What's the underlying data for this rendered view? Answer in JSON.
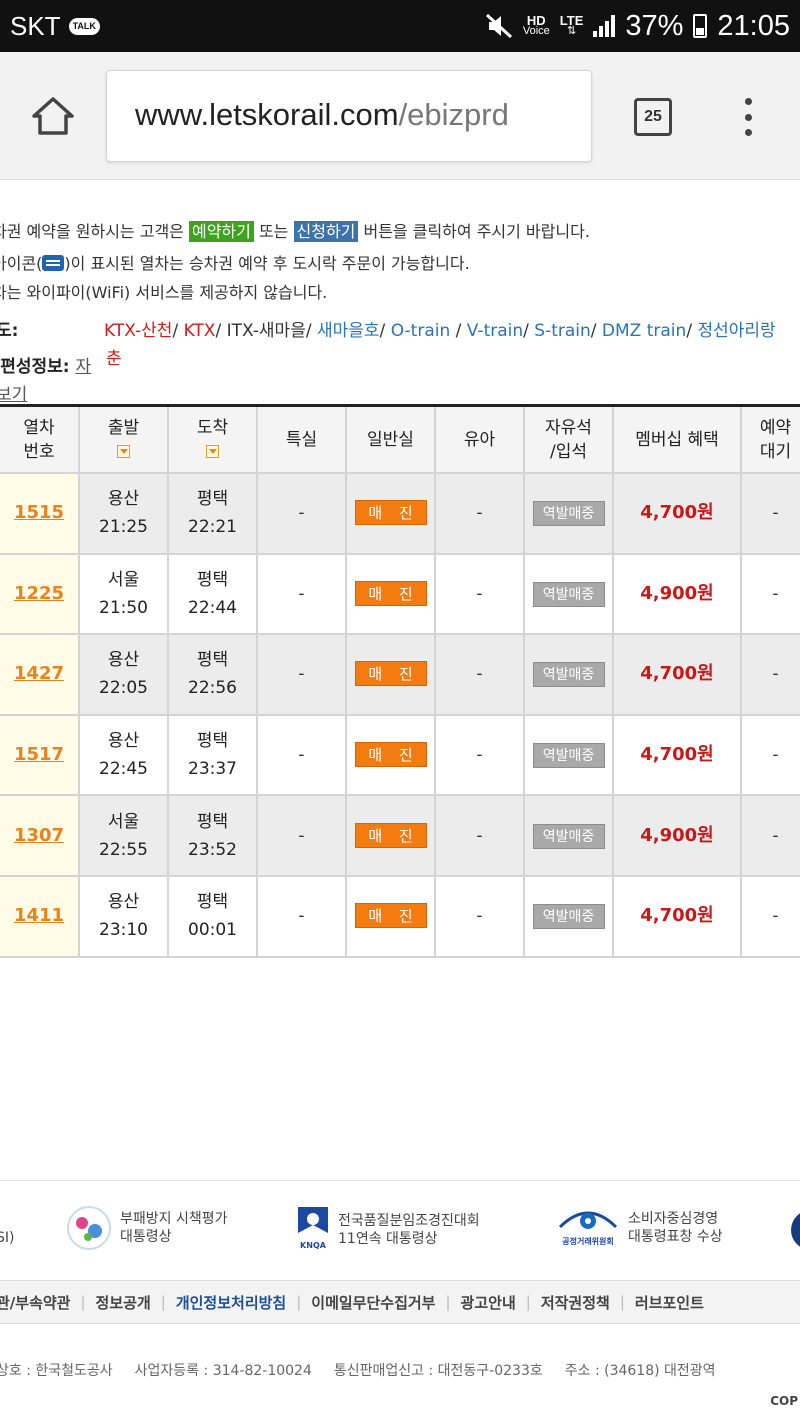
{
  "status": {
    "carrier": "SKT",
    "talk_badge": "TALK",
    "hd_label": "HD",
    "voice_label": "Voice",
    "lte_label": "LTE",
    "battery": "37%",
    "time": "21:05"
  },
  "browser": {
    "url_host": "www.letskorail.com",
    "url_path": "/ebizprd",
    "tab_count": "25"
  },
  "notices": {
    "line1_a": "차권 예약을 원하시는 고객은 ",
    "line1_reserve": "예약하기",
    "line1_b": " 또는 ",
    "line1_apply": "신청하기",
    "line1_c": " 버튼을 클릭하여 주시기 바랍니다.",
    "line2_a": "아이콘(",
    "line2_b": ")이 표시된 열차는 승차권 예약 후 도시락 주문이 가능합니다.",
    "line3": "차는 와이파이(WiFi) 서비스를 제공하지 않습니다."
  },
  "legend": {
    "label": "도:",
    "ktx_sancheon": "KTX-산천",
    "ktx": "KTX",
    "itx": "ITX-새마을",
    "saemaeul": "새마을호",
    "otrain": "O-train",
    "vtrain": "V-train",
    "strain": "S-train",
    "dmz": "DMZ train",
    "jeongseon": "정선아리랑",
    "wrap": "춘",
    "sep": "/ "
  },
  "composition": {
    "label": "/편성정보:",
    "link_a": "자",
    "link_b": "보기"
  },
  "table": {
    "headers": {
      "train_no_1": "열차",
      "train_no_2": "번호",
      "depart": "출발",
      "arrive": "도착",
      "special": "특실",
      "general": "일반실",
      "infant": "유아",
      "free_1": "자유석",
      "free_2": "/입석",
      "membership": "멤버십 혜택",
      "wait_1": "예약",
      "wait_2": "대기"
    },
    "soldout_label": "매 진",
    "station_label": "역발매중",
    "dash": "-",
    "rows": [
      {
        "no": "1515",
        "from": "용산",
        "dep": "21:25",
        "to": "평택",
        "arr": "22:21",
        "price": "4,700원"
      },
      {
        "no": "1225",
        "from": "서울",
        "dep": "21:50",
        "to": "평택",
        "arr": "22:44",
        "price": "4,900원"
      },
      {
        "no": "1427",
        "from": "용산",
        "dep": "22:05",
        "to": "평택",
        "arr": "22:56",
        "price": "4,700원"
      },
      {
        "no": "1517",
        "from": "용산",
        "dep": "22:45",
        "to": "평택",
        "arr": "23:37",
        "price": "4,700원"
      },
      {
        "no": "1307",
        "from": "서울",
        "dep": "22:55",
        "to": "평택",
        "arr": "23:52",
        "price": "4,900원"
      },
      {
        "no": "1411",
        "from": "용산",
        "dep": "23:10",
        "to": "평택",
        "arr": "00:01",
        "price": "4,700원"
      }
    ]
  },
  "footer": {
    "logo_partial": "SI)",
    "award1_a": "부패방지 시책평가",
    "award1_b": "대통령상",
    "award2_a": "전국품질분임조경진대회",
    "award2_b": "11연속 대통령상",
    "award2_logo": "KNQA",
    "award3_a": "소비자중심경영",
    "award3_b": "대통령표창 수상",
    "award3_logo": "공정거래위원회",
    "nav": [
      "관/부속약관",
      "정보공개",
      "개인정보처리방침",
      "이메일무단수집거부",
      "광고안내",
      "저작권정책",
      "러브포인트"
    ],
    "info_company": "상호 : 한국철도공사",
    "info_reg": "사업자등록 : 314-82-10024",
    "info_mail": "통신판매업신고 : 대전동구-0233호",
    "info_addr": "주소 : (34618) 대전광역",
    "copyright": "COP"
  },
  "colors": {
    "soldout": "#f47b0f",
    "price": "#c91818",
    "train_link": "#e8831d",
    "highlight_green": "#3ea31f",
    "highlight_blue": "#3d73ad"
  }
}
